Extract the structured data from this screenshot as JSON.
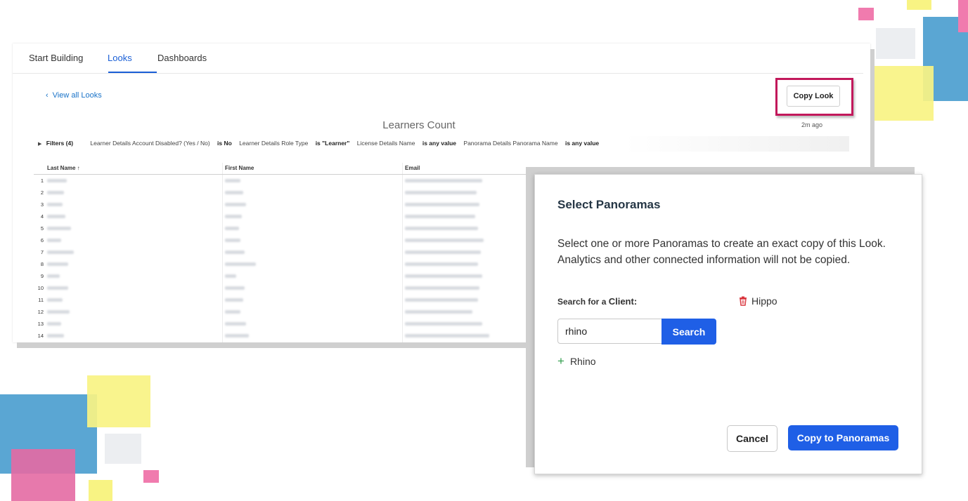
{
  "colors": {
    "accent": "#1f5fe6",
    "link": "#1a73c8",
    "highlight": "#c2185b",
    "deco_blue": "#5aa6d3",
    "deco_yellow": "#f8f383",
    "deco_pink": "#f07bae",
    "deco_gray": "#eceef1",
    "delete_red": "#d9363e",
    "add_green": "#2e9d4a"
  },
  "tabs": [
    {
      "label": "Start Building",
      "active": false
    },
    {
      "label": "Looks",
      "active": true
    },
    {
      "label": "Dashboards",
      "active": false
    }
  ],
  "look": {
    "back_label": "View all Looks",
    "copy_button_label": "Copy Look",
    "title": "Learners Count",
    "updated": "2m ago",
    "filters_label": "Filters (4)",
    "filters": [
      {
        "name": "Learner Details Account Disabled? (Yes / No)",
        "op": "is No"
      },
      {
        "name": "Learner Details Role Type",
        "op": "is \"Learner\""
      },
      {
        "name": "License Details Name",
        "op": "is any value"
      },
      {
        "name": "Panorama Details Panorama Name",
        "op": "is any value"
      }
    ]
  },
  "table": {
    "columns": [
      "Last Name ↑",
      "First Name",
      "Email"
    ],
    "row_numbers": [
      "1",
      "2",
      "3",
      "4",
      "5",
      "6",
      "7",
      "8",
      "9",
      "10",
      "11",
      "12",
      "13",
      "14"
    ]
  },
  "modal": {
    "title": "Select Panoramas",
    "description": "Select one or more Panoramas to create an exact copy of this Look. Analytics and other connected information will not be copied.",
    "search_label_prefix": "Search for a",
    "search_label_entity": "Client:",
    "selected": [
      "Hippo"
    ],
    "search_value": "rhino",
    "search_button": "Search",
    "results": [
      "Rhino"
    ],
    "cancel_label": "Cancel",
    "submit_label": "Copy to Panoramas"
  },
  "icons": {
    "back": "chevron-left-icon",
    "filter_toggle": "caret-right-icon",
    "delete": "trash-icon",
    "add": "plus-icon"
  }
}
